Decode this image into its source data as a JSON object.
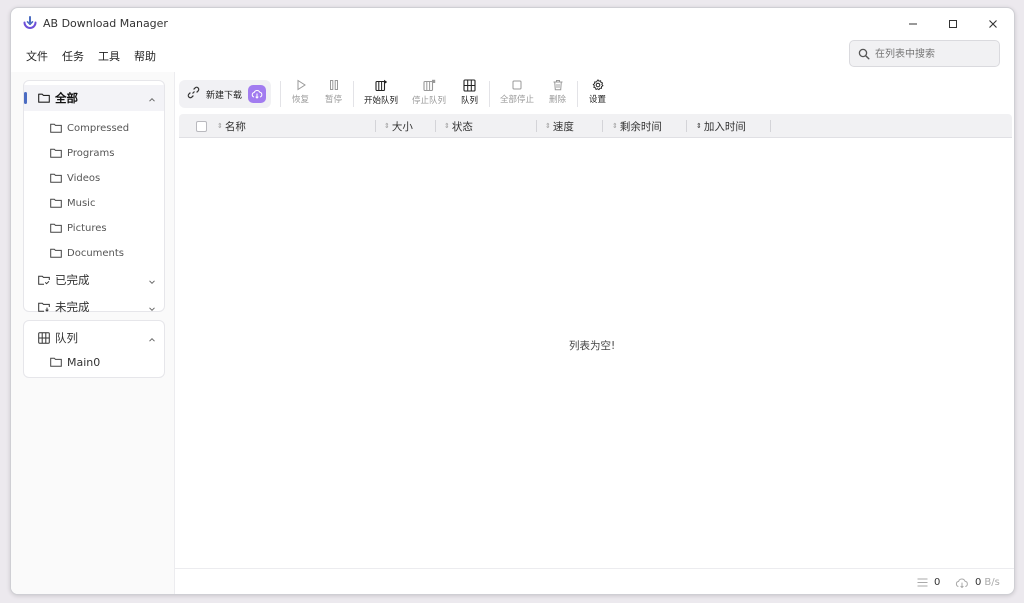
{
  "app": {
    "title": "AB Download Manager"
  },
  "colors": {
    "accent": "#4b6cc2",
    "new_download_badge": "#a27cf0"
  },
  "menu": [
    "文件",
    "任务",
    "工具",
    "帮助"
  ],
  "search": {
    "placeholder": "在列表中搜索",
    "value": ""
  },
  "sidebar": {
    "categories": {
      "all": {
        "label": "全部",
        "expanded": true
      },
      "completed": {
        "label": "已完成"
      },
      "unfinished": {
        "label": "未完成"
      }
    },
    "subcategories": [
      "Compressed",
      "Programs",
      "Videos",
      "Music",
      "Pictures",
      "Documents"
    ],
    "queues": {
      "label": "队列",
      "items": [
        {
          "name": "Main",
          "count": "0"
        }
      ]
    }
  },
  "toolbar": {
    "new_download": "新建下载",
    "buttons": {
      "resume": "恢复",
      "pause": "暂停",
      "start_queue": "开始队列",
      "stop_queue": "停止队列",
      "queue": "队列",
      "stop_all": "全部停止",
      "delete": "删除",
      "settings": "设置"
    }
  },
  "table": {
    "columns": {
      "name": "名称",
      "size": "大小",
      "status": "状态",
      "speed": "速度",
      "remaining": "剩余时间",
      "added": "加入时间"
    },
    "empty_message": "列表为空!"
  },
  "status_bar": {
    "active_count": "0",
    "speed": "0",
    "speed_unit": "B/s"
  }
}
